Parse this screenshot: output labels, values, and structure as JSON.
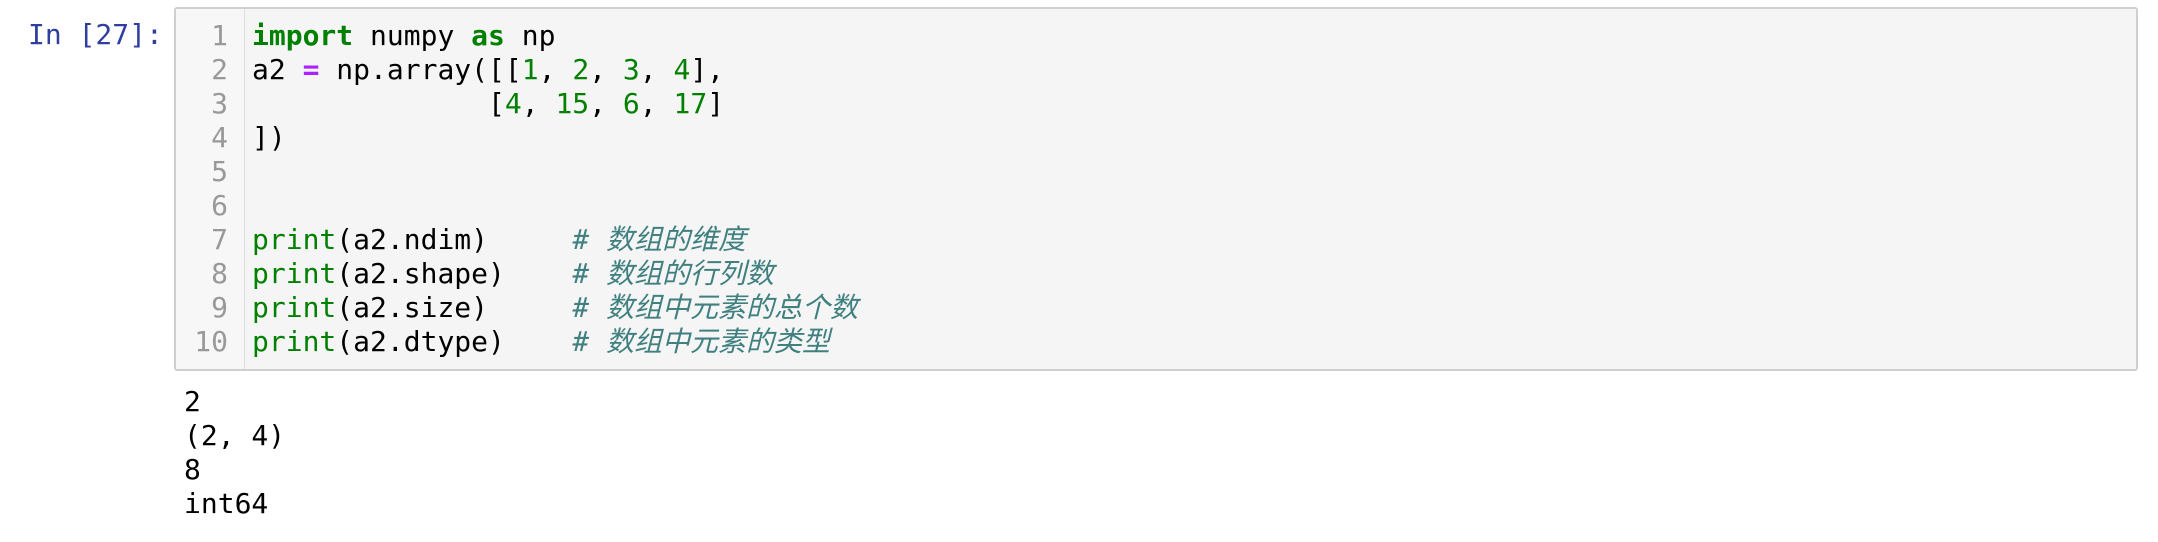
{
  "cell": {
    "prompt": "In [27]:",
    "line_numbers": [
      "1",
      "2",
      "3",
      "4",
      "5",
      "6",
      "7",
      "8",
      "9",
      "10"
    ],
    "code": {
      "l1": {
        "kw_import": "import",
        "t1": " numpy ",
        "kw_as": "as",
        "t2": " np"
      },
      "l2": {
        "t1": "a2 ",
        "op": "=",
        "t2": " np.array([[",
        "n1": "1",
        "c1": ", ",
        "n2": "2",
        "c2": ", ",
        "n3": "3",
        "c3": ", ",
        "n4": "4",
        "t3": "],"
      },
      "l3": {
        "t1": "              [",
        "n1": "4",
        "c1": ", ",
        "n2": "15",
        "c2": ", ",
        "n3": "6",
        "c3": ", ",
        "n4": "17",
        "t2": "]"
      },
      "l4": {
        "t1": "])"
      },
      "l7": {
        "fn": "print",
        "args": "(a2.ndim)     ",
        "comment": "# 数组的维度"
      },
      "l8": {
        "fn": "print",
        "args": "(a2.shape)    ",
        "comment": "# 数组的行列数"
      },
      "l9": {
        "fn": "print",
        "args": "(a2.size)     ",
        "comment": "# 数组中元素的总个数"
      },
      "l10": {
        "fn": "print",
        "args": "(a2.dtype)    ",
        "comment": "# 数组中元素的类型"
      }
    }
  },
  "output": [
    "2",
    "(2, 4)",
    "8",
    "int64"
  ],
  "colors": {
    "prompt": "#303f9f",
    "keyword": "#008000",
    "operator": "#aa22ff",
    "comment": "#408080",
    "cell_bg": "#f5f5f5",
    "cell_border": "#cfcfcf"
  }
}
